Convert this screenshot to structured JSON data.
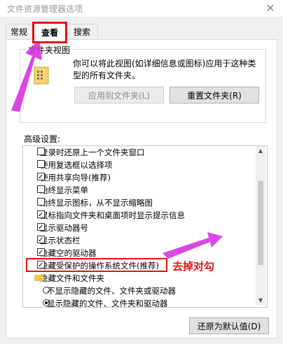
{
  "window": {
    "title": "文件资源管理器选项"
  },
  "tabs": [
    {
      "label": "常规"
    },
    {
      "label": "查看"
    },
    {
      "label": "搜索"
    }
  ],
  "folder_view": {
    "title": "文件夹视图",
    "description": "你可以将此视图(如详细信息或图标)应用于这种类型的所有文件夹。",
    "apply_label": "应用到文件夹(L)",
    "reset_label": "重置文件夹(R)"
  },
  "advanced": {
    "label": "高级设置:",
    "items": [
      {
        "label": "登录时还原上一个文件夹窗口",
        "type": "checkbox",
        "checked": false
      },
      {
        "label": "使用复选框以选择项",
        "type": "checkbox",
        "checked": false
      },
      {
        "label": "使用共享向导(推荐)",
        "type": "checkbox",
        "checked": true
      },
      {
        "label": "始终显示菜单",
        "type": "checkbox",
        "checked": false
      },
      {
        "label": "始终显示图标，从不显示缩略图",
        "type": "checkbox",
        "checked": false
      },
      {
        "label": "鼠标指向文件夹和桌面项时显示提示信息",
        "type": "checkbox",
        "checked": true
      },
      {
        "label": "显示驱动器号",
        "type": "checkbox",
        "checked": true
      },
      {
        "label": "显示状态栏",
        "type": "checkbox",
        "checked": true
      },
      {
        "label": "隐藏空的驱动器",
        "type": "checkbox",
        "checked": true
      },
      {
        "label": "隐藏受保护的操作系统文件(推荐)",
        "type": "checkbox",
        "checked": true
      },
      {
        "label": "隐藏文件和文件夹",
        "type": "folder"
      },
      {
        "label": "不显示隐藏的文件、文件夹或驱动器",
        "type": "radio",
        "checked": false
      },
      {
        "label": "显示隐藏的文件、文件夹和驱动器",
        "type": "radio",
        "checked": true
      }
    ],
    "restore_label": "还原为默认值(D)"
  },
  "annotation": {
    "text": "去掉对勾",
    "color": "#ee1111"
  },
  "colors": {
    "highlight": "#e81010",
    "arrow": "#d633e0"
  }
}
